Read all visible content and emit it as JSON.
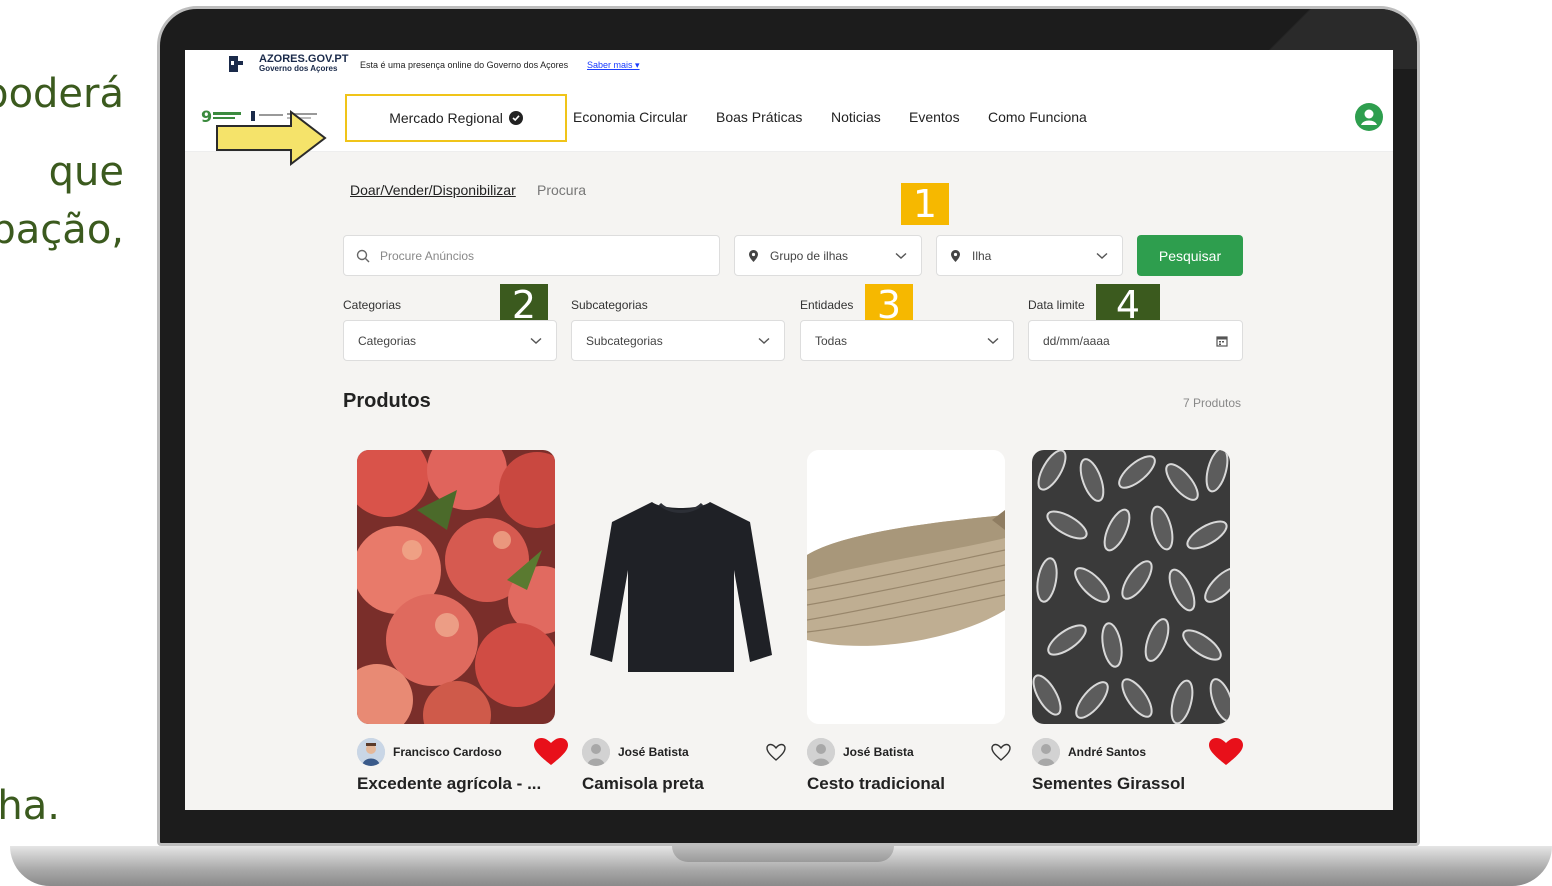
{
  "slide": {
    "fragments": [
      "poderá",
      "que",
      "pação,",
      "ha."
    ]
  },
  "gov_bar": {
    "name": "AZORES.GOV.PT",
    "subtitle": "Governo dos Açores",
    "message": "Esta é uma presença online do Governo dos Açores",
    "link": "Saber mais ▾"
  },
  "nav": {
    "active": "Mercado Regional",
    "items": [
      "Economia Circular",
      "Boas Práticas",
      "Noticias",
      "Eventos",
      "Como Funciona"
    ]
  },
  "tabs": [
    "Doar/Vender/Disponibilizar",
    "Procura"
  ],
  "search": {
    "placeholder": "Procure Anúncios",
    "group": "Grupo de ilhas",
    "island": "Ilha",
    "button": "Pesquisar"
  },
  "filters": {
    "categories_label": "Categorias",
    "categories_value": "Categorias",
    "subcategories_label": "Subcategorias",
    "subcategories_value": "Subcategorias",
    "entities_label": "Entidades",
    "entities_value": "Todas",
    "date_label": "Data limite",
    "date_value": "dd/mm/aaaa"
  },
  "badges": [
    "1",
    "2",
    "3",
    "4"
  ],
  "products": {
    "title": "Produtos",
    "count": "7 Produtos",
    "items": [
      {
        "seller": "Francisco Cardoso",
        "title": "Excedente agrícola - ...",
        "favorite": true
      },
      {
        "seller": "José Batista",
        "title": "Camisola preta",
        "favorite": false
      },
      {
        "seller": "José Batista",
        "title": "Cesto tradicional",
        "favorite": false
      },
      {
        "seller": "André Santos",
        "title": "Sementes Girassol",
        "favorite": true
      }
    ]
  },
  "colors": {
    "accent_green": "#2e9e4e",
    "badge_yellow": "#f6b800",
    "badge_green": "#3b5a1e",
    "heart_red": "#e8101a"
  }
}
